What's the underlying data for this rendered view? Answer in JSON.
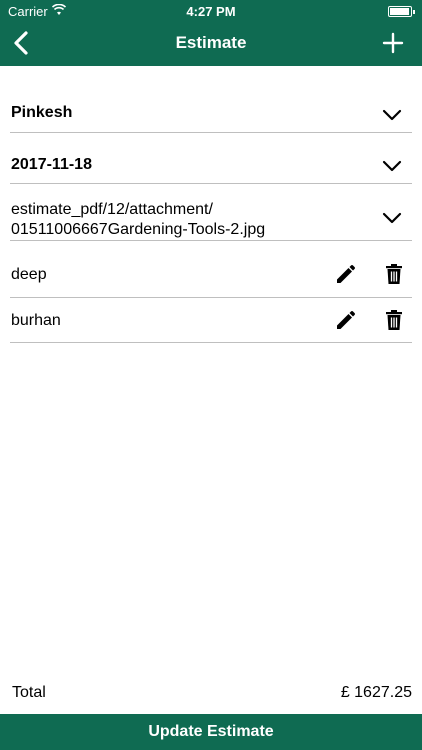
{
  "status_bar": {
    "carrier": "Carrier",
    "time": "4:27 PM"
  },
  "header": {
    "title": "Estimate"
  },
  "fields": {
    "customer": "Pinkesh",
    "date": "2017-11-18",
    "attachment_line1": "estimate_pdf/12/attachment/",
    "attachment_line2": "01511006667Gardening-Tools-2.jpg"
  },
  "items": [
    {
      "name": "deep"
    },
    {
      "name": "burhan"
    }
  ],
  "total": {
    "label": "Total",
    "value": "£ 1627.25"
  },
  "actions": {
    "update_label": "Update Estimate"
  },
  "colors": {
    "brand": "#0f6b52",
    "divider": "#bfbfbf"
  }
}
